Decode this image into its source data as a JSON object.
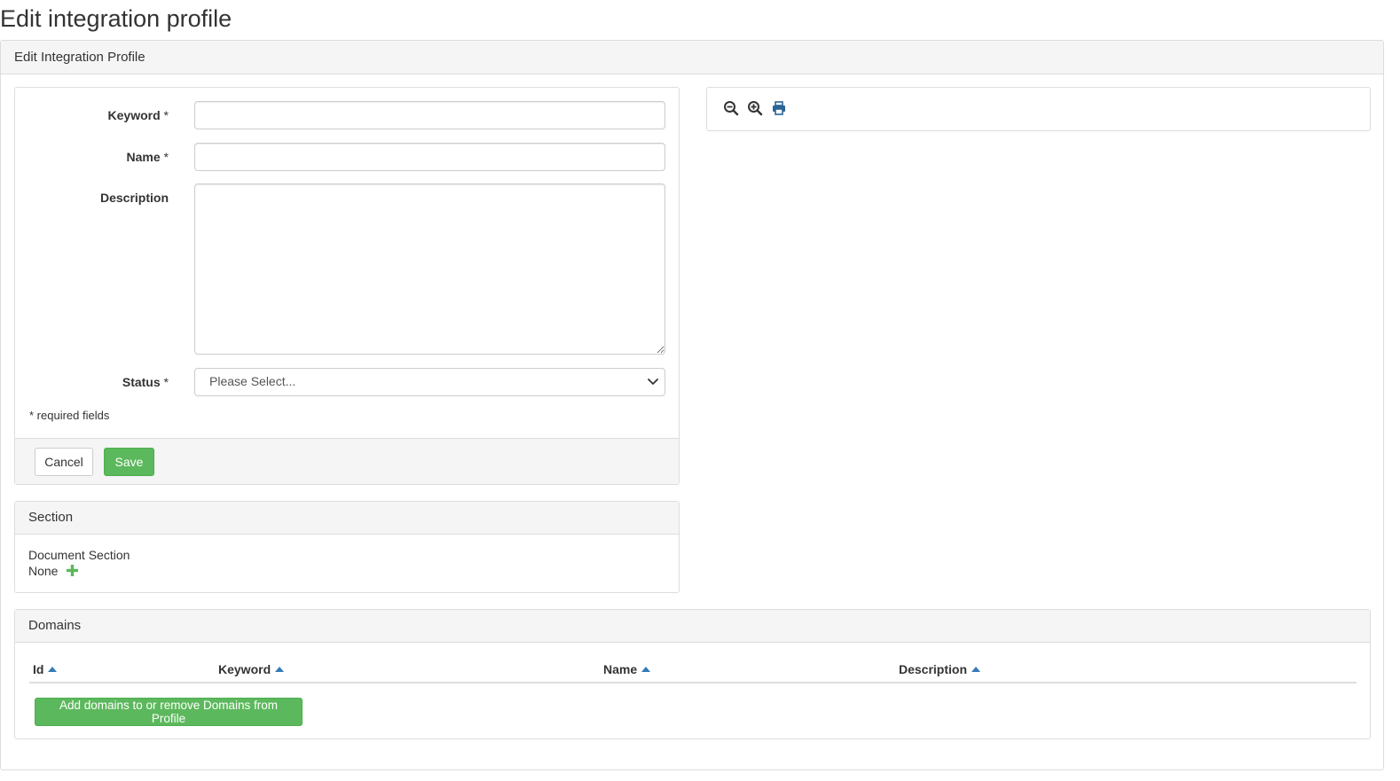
{
  "page": {
    "title": "Edit integration profile"
  },
  "panel": {
    "heading": "Edit Integration Profile"
  },
  "form": {
    "keyword_label": "Keyword",
    "name_label": "Name",
    "description_label": "Description",
    "status_label": "Status",
    "required_marker": "*",
    "keyword_value": "",
    "name_value": "",
    "description_value": "",
    "status_selected": "Please Select...",
    "required_note": "* required fields",
    "cancel_label": "Cancel",
    "save_label": "Save"
  },
  "toolbar": {
    "icons": [
      "zoom-out-icon",
      "zoom-in-icon",
      "print-icon"
    ],
    "icon_color": "#333333"
  },
  "section": {
    "heading": "Section",
    "document_section_label": "Document Section",
    "document_section_value": "None",
    "add_icon": "plus-icon"
  },
  "domains": {
    "heading": "Domains",
    "columns": [
      "Id",
      "Keyword",
      "Name",
      "Description"
    ],
    "rows": [],
    "add_button_label": "Add domains to or remove Domains from Profile"
  },
  "colors": {
    "success": "#5cb85c",
    "sort_arrow": "#337ab7",
    "panel_heading_bg": "#f5f5f5",
    "border": "#dddddd"
  }
}
